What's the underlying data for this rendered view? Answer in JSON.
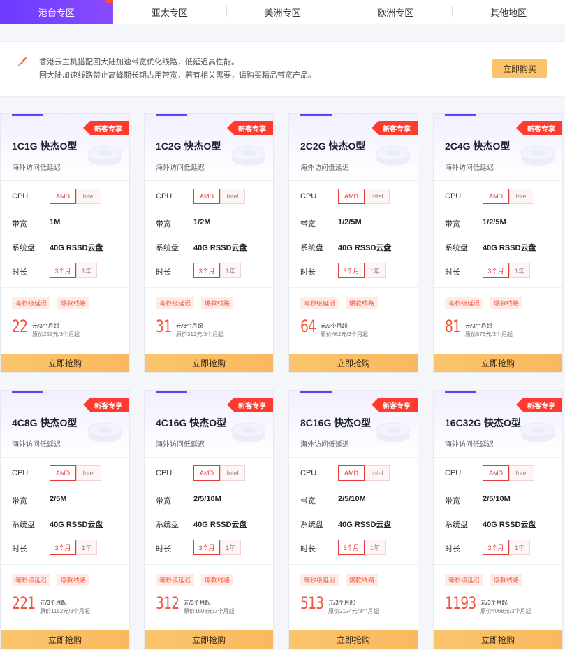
{
  "tabs": [
    "港台专区",
    "亚太专区",
    "美洲专区",
    "欧洲专区",
    "其他地区"
  ],
  "notice": {
    "line1": "香港云主机搭配回大陆加速带宽优化线路，低延迟高性能。",
    "line2": "回大陆加速线路禁止高峰期长期占用带宽，若有相关需要，请购买精品带宽产品。",
    "buy_label": "立即购买"
  },
  "labels": {
    "badge": "新客专享",
    "subtitle": "海外访问低延迟",
    "cpu": "CPU",
    "bandwidth": "带宽",
    "disk": "系统盘",
    "duration": "时长",
    "amd": "AMD",
    "intel": "Intel",
    "three_month": "3个月",
    "one_year": "1年",
    "tag1": "毫秒级延迟",
    "tag2": "爆款线路",
    "price_unit": "元/3个月起",
    "buy_now": "立即抢购"
  },
  "colors": {
    "accent": "#6a3cff",
    "badge": "#ff3b2f",
    "price": "#f0563e",
    "button": "#fbc56c"
  },
  "products": [
    {
      "title": "1C1G 快杰O型",
      "bandwidth": "1M",
      "disk": "40G RSSD云盘",
      "price": "22",
      "original": "原价255元/3个月起"
    },
    {
      "title": "1C2G 快杰O型",
      "bandwidth": "1/2M",
      "disk": "40G RSSD云盘",
      "price": "31",
      "original": "原价312元/3个月起"
    },
    {
      "title": "2C2G 快杰O型",
      "bandwidth": "1/2/5M",
      "disk": "40G RSSD云盘",
      "price": "64",
      "original": "原价462元/3个月起"
    },
    {
      "title": "2C4G 快杰O型",
      "bandwidth": "1/2/5M",
      "disk": "40G RSSD云盘",
      "price": "81",
      "original": "原价576元/3个月起"
    },
    {
      "title": "4C8G 快杰O型",
      "bandwidth": "2/5M",
      "disk": "40G RSSD云盘",
      "price": "221",
      "original": "原价1152元/3个月起"
    },
    {
      "title": "4C16G 快杰O型",
      "bandwidth": "2/5/10M",
      "disk": "40G RSSD云盘",
      "price": "312",
      "original": "原价1608元/3个月起"
    },
    {
      "title": "8C16G 快杰O型",
      "bandwidth": "2/5/10M",
      "disk": "40G RSSD云盘",
      "price": "513",
      "original": "原价2124元/3个月起"
    },
    {
      "title": "16C32G 快杰O型",
      "bandwidth": "2/5/10M",
      "disk": "40G RSSD云盘",
      "price": "1193",
      "original": "原价4068元/3个月起"
    }
  ]
}
